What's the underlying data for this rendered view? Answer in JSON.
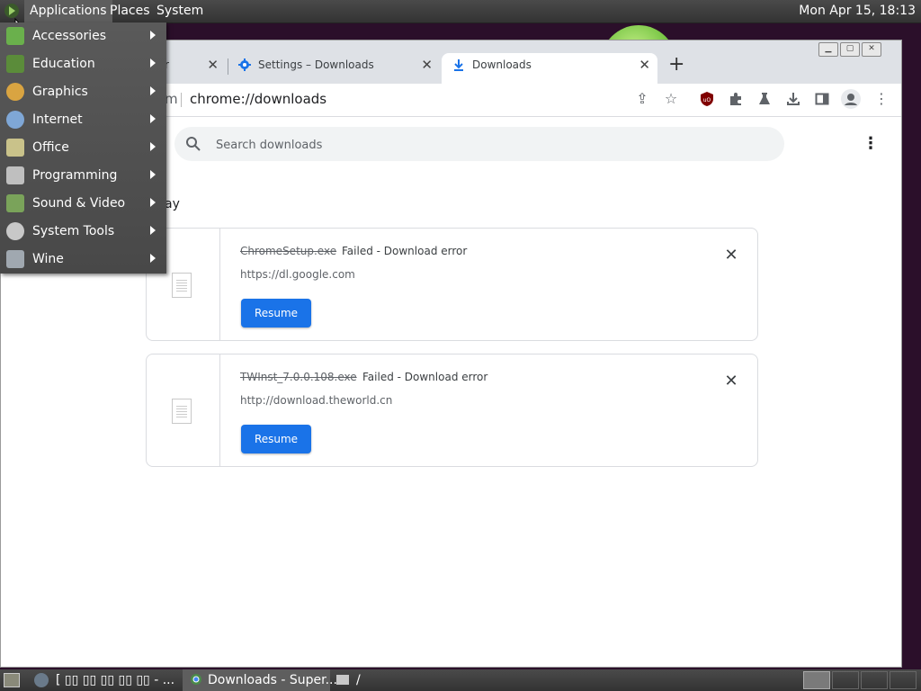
{
  "top_panel": {
    "menus": [
      "Applications",
      "Places",
      "System"
    ],
    "clock": "Mon Apr 15, 18:13"
  },
  "app_menu": {
    "items": [
      {
        "label": "Accessories",
        "icon": "accessories-icon",
        "color": "#6ab04c"
      },
      {
        "label": "Education",
        "icon": "education-icon",
        "color": "#5b8c3a"
      },
      {
        "label": "Graphics",
        "icon": "graphics-icon",
        "color": "#d9a441"
      },
      {
        "label": "Internet",
        "icon": "internet-icon",
        "color": "#7fa7d6"
      },
      {
        "label": "Office",
        "icon": "office-icon",
        "color": "#c9c28a"
      },
      {
        "label": "Programming",
        "icon": "programming-icon",
        "color": "#bfbfbf"
      },
      {
        "label": "Sound & Video",
        "icon": "sound-video-icon",
        "color": "#7aa35a"
      },
      {
        "label": "System Tools",
        "icon": "system-tools-icon",
        "color": "#c8c8c8"
      },
      {
        "label": "Wine",
        "icon": "wine-icon",
        "color": "#a0a8b0"
      }
    ]
  },
  "browser": {
    "tabs": [
      {
        "title": "r",
        "active": false
      },
      {
        "title": "Settings – Downloads",
        "active": false
      },
      {
        "title": "Downloads",
        "active": true
      }
    ],
    "omnibox_prefix": "m",
    "omnibox_url": "chrome://downloads",
    "search_placeholder": "Search downloads",
    "date_label": "ay",
    "downloads": [
      {
        "filename": "ChromeSetup.exe",
        "status": "Failed - Download error",
        "url": "https://dl.google.com",
        "action": "Resume"
      },
      {
        "filename": "TWInst_7.0.0.108.exe",
        "status": "Failed - Download error",
        "url": "http://download.theworld.cn",
        "action": "Resume"
      }
    ]
  },
  "bottom_panel": {
    "tasks": [
      "[ ▯▯ ▯▯ ▯▯ ▯▯ ▯▯ - ...",
      "Downloads - Super...",
      "/"
    ]
  },
  "colors": {
    "accent": "#1a73e8",
    "panel": "#3c3c3c"
  }
}
